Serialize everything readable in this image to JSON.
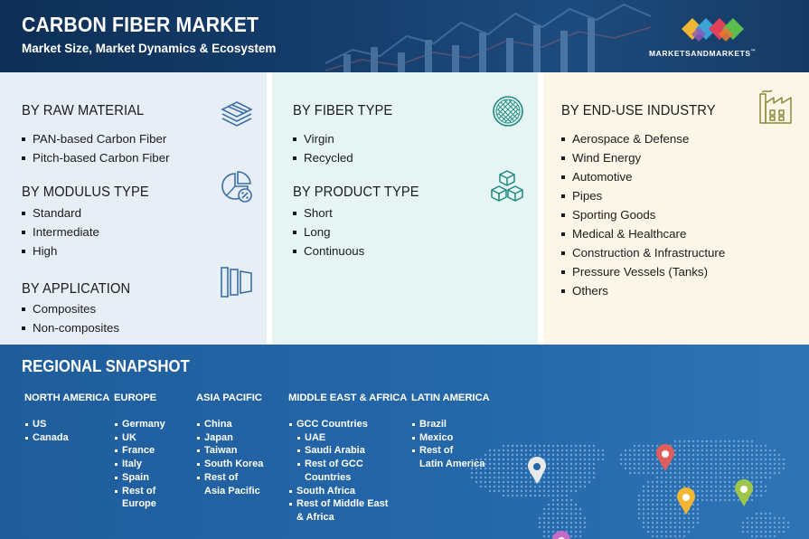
{
  "header": {
    "title": "CARBON FIBER MARKET",
    "subtitle": "Market Size, Market Dynamics & Ecosystem",
    "logo_text": "MARKETSANDMARKETS",
    "logo_tm": "™"
  },
  "segments": {
    "raw_material": {
      "title": "BY RAW MATERIAL",
      "icon": "layers-icon",
      "items": [
        "PAN-based Carbon Fiber",
        "Pitch-based Carbon Fiber"
      ]
    },
    "modulus_type": {
      "title": "BY MODULUS TYPE",
      "icon": "pie-chart-percent-icon",
      "items": [
        "Standard",
        "Intermediate",
        "High"
      ]
    },
    "application": {
      "title": "BY APPLICATION",
      "icon": "panels-icon",
      "items": [
        "Composites",
        "Non-composites"
      ]
    },
    "fiber_type": {
      "title": "BY FIBER TYPE",
      "icon": "fiber-weave-icon",
      "items": [
        "Virgin",
        "Recycled"
      ]
    },
    "product_type": {
      "title": "BY PRODUCT TYPE",
      "icon": "stacked-cubes-icon",
      "items": [
        "Short",
        "Long",
        "Continuous"
      ]
    },
    "end_use": {
      "title": "BY END-USE INDUSTRY",
      "icon": "factory-icon",
      "items": [
        "Aerospace & Defense",
        "Wind Energy",
        "Automotive",
        "Pipes",
        "Sporting Goods",
        "Medical & Healthcare",
        "Construction & Infrastructure",
        "Pressure Vessels (Tanks)",
        "Others"
      ]
    }
  },
  "regional": {
    "title": "REGIONAL SNAPSHOT",
    "north_america": {
      "title": "NORTH AMERICA",
      "items": [
        "US",
        "Canada"
      ]
    },
    "europe": {
      "title": "EUROPE",
      "items": [
        "Germany",
        "UK",
        "France",
        "Italy",
        "Spain",
        "Rest of",
        "Europe"
      ]
    },
    "asia_pacific": {
      "title": "ASIA PACIFIC",
      "items": [
        "China",
        "Japan",
        "Taiwan",
        "South Korea",
        "Rest of",
        "Asia Pacific"
      ]
    },
    "mea": {
      "title": "MIDDLE EAST & AFRICA",
      "items": [
        "GCC Countries",
        "UAE",
        "Saudi Arabia",
        "Rest of GCC",
        "Countries",
        "South Africa",
        "Rest of Middle East",
        "& Africa"
      ]
    },
    "latin_america": {
      "title": "LATIN AMERICA",
      "items": [
        "Brazil",
        "Mexico",
        "Rest of",
        "Latin America"
      ]
    }
  },
  "colors": {
    "header_bg": "#0d2f56",
    "raw_panel_bg": "#e8eef6",
    "fiber_panel_bg": "#e6f5f3",
    "enduse_panel_bg": "#fbf6e7",
    "region_bg": "#2467a9",
    "icon_blue": "#3a6ea5",
    "icon_teal": "#1f8a80",
    "icon_olive": "#8a8a3a",
    "pin_north_america": "#e9e9e9",
    "pin_asia": "#e05d5d",
    "pin_mea": "#f2b632",
    "pin_oceania": "#9fc54a",
    "pin_latin_america": "#c86ac8"
  }
}
